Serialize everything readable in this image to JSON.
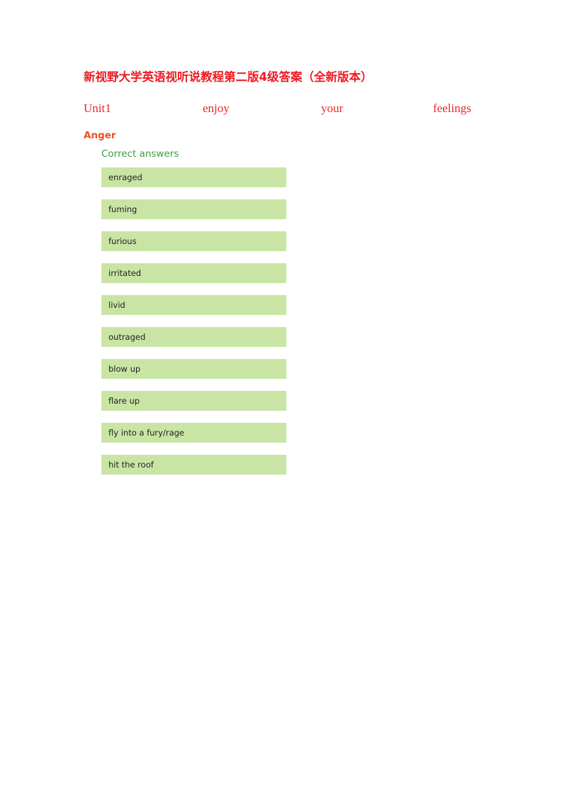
{
  "document": {
    "title": "新视野大学英语视听说教程第二版4级答案（全新版本）",
    "title_color": "#ee1c23",
    "unit_line": {
      "words": [
        "Unit1",
        "enjoy",
        "your",
        "feelings"
      ],
      "color": "#e8262c"
    },
    "section": {
      "heading": "Anger",
      "heading_color": "#e8531f",
      "answers_label": "Correct answers",
      "answers_label_color": "#3f9a3f",
      "answer_box_color": "#c9e5a5",
      "answers": [
        "enraged",
        "fuming",
        "furious",
        "irritated",
        "livid",
        "outraged",
        "blow up",
        "flare up",
        "fly into a fury/rage",
        "hit the roof"
      ]
    }
  }
}
